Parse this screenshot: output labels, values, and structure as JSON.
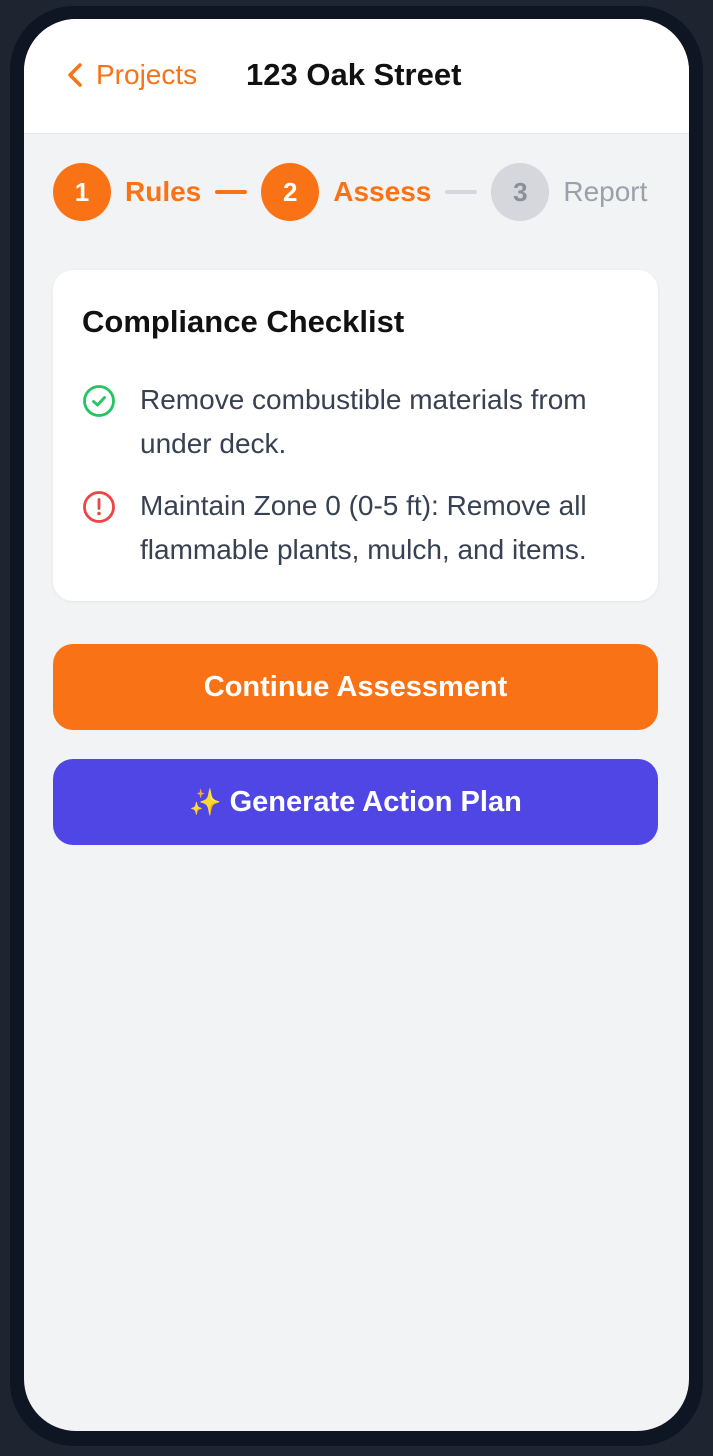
{
  "header": {
    "back_label": "Projects",
    "title": "123 Oak Street"
  },
  "stepper": {
    "steps": [
      {
        "number": "1",
        "label": "Rules",
        "state": "complete"
      },
      {
        "number": "2",
        "label": "Assess",
        "state": "active"
      },
      {
        "number": "3",
        "label": "Report",
        "state": "pending"
      }
    ]
  },
  "checklist": {
    "title": "Compliance Checklist",
    "items": [
      {
        "text": "Remove combustible materials from under deck.",
        "status": "complete",
        "icon": "check-circle-icon",
        "color": "#22c55e"
      },
      {
        "text": "Maintain Zone 0 (0-5 ft): Remove all flammable plants, mulch, and items.",
        "status": "warning",
        "icon": "alert-circle-icon",
        "color": "#ef4444"
      }
    ]
  },
  "actions": {
    "continue_label": "Continue Assessment",
    "generate_icon": "✨",
    "generate_label": "Generate Action Plan"
  },
  "colors": {
    "accent": "#f97316",
    "primary_purple": "#4f46e5",
    "inactive": "#d5d7dd"
  }
}
